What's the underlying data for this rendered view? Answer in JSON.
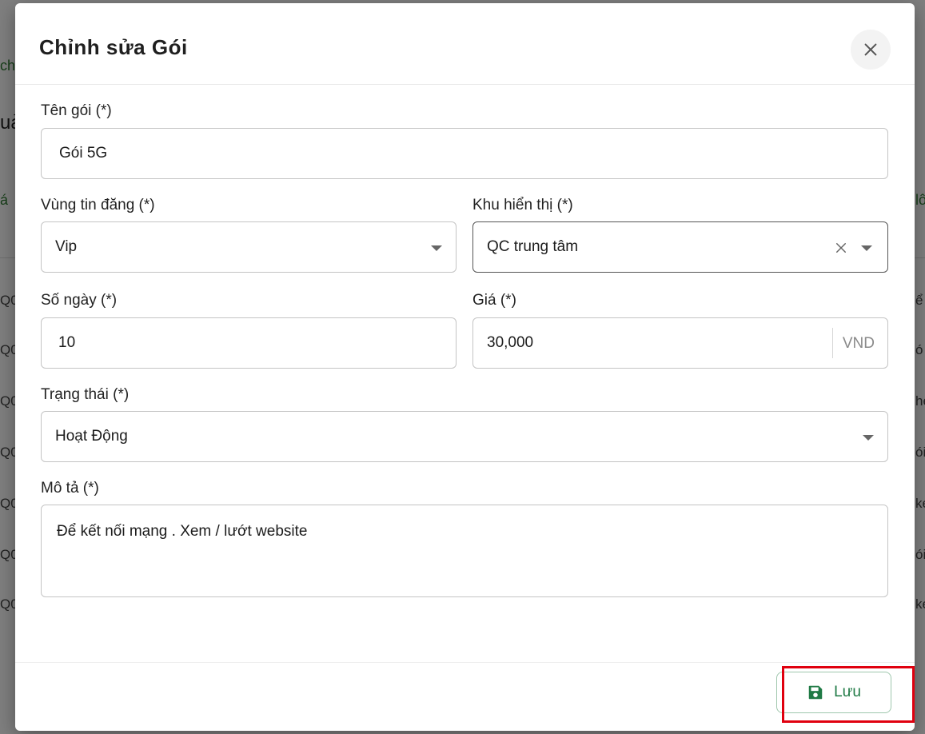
{
  "modal": {
    "title": "Chỉnh sửa Gói",
    "fields": {
      "name": {
        "label": "Tên gói (*)",
        "value": "Gói 5G"
      },
      "region": {
        "label": "Vùng tin đăng (*)",
        "value": "Vip"
      },
      "display_area": {
        "label": "Khu hiển thị (*)",
        "value": "QC trung tâm"
      },
      "days": {
        "label": "Số ngày (*)",
        "value": "10"
      },
      "price": {
        "label": "Giá (*)",
        "value": "30,000",
        "unit": "VND"
      },
      "status": {
        "label": "Trạng thái (*)",
        "value": "Hoạt Động"
      },
      "description": {
        "label": "Mô tả (*)",
        "value": "Để kết nối mạng . Xem / lướt website"
      }
    },
    "save_label": "Lưu"
  },
  "background": {
    "fragments": [
      "chu",
      "uả",
      "á",
      "lô",
      "ể",
      "ó",
      "he",
      "ói",
      "ke",
      "ói",
      "ke"
    ],
    "rows": [
      "Q0",
      "Q0",
      "Q0",
      "Q0",
      "Q0",
      "Q0",
      "Q0"
    ]
  },
  "colors": {
    "accent_green": "#1f7a45",
    "highlight_red": "#e0000f",
    "border": "#c4c4c4"
  },
  "icons": [
    "close-icon",
    "chevron-down-icon",
    "clear-icon",
    "save-icon"
  ]
}
